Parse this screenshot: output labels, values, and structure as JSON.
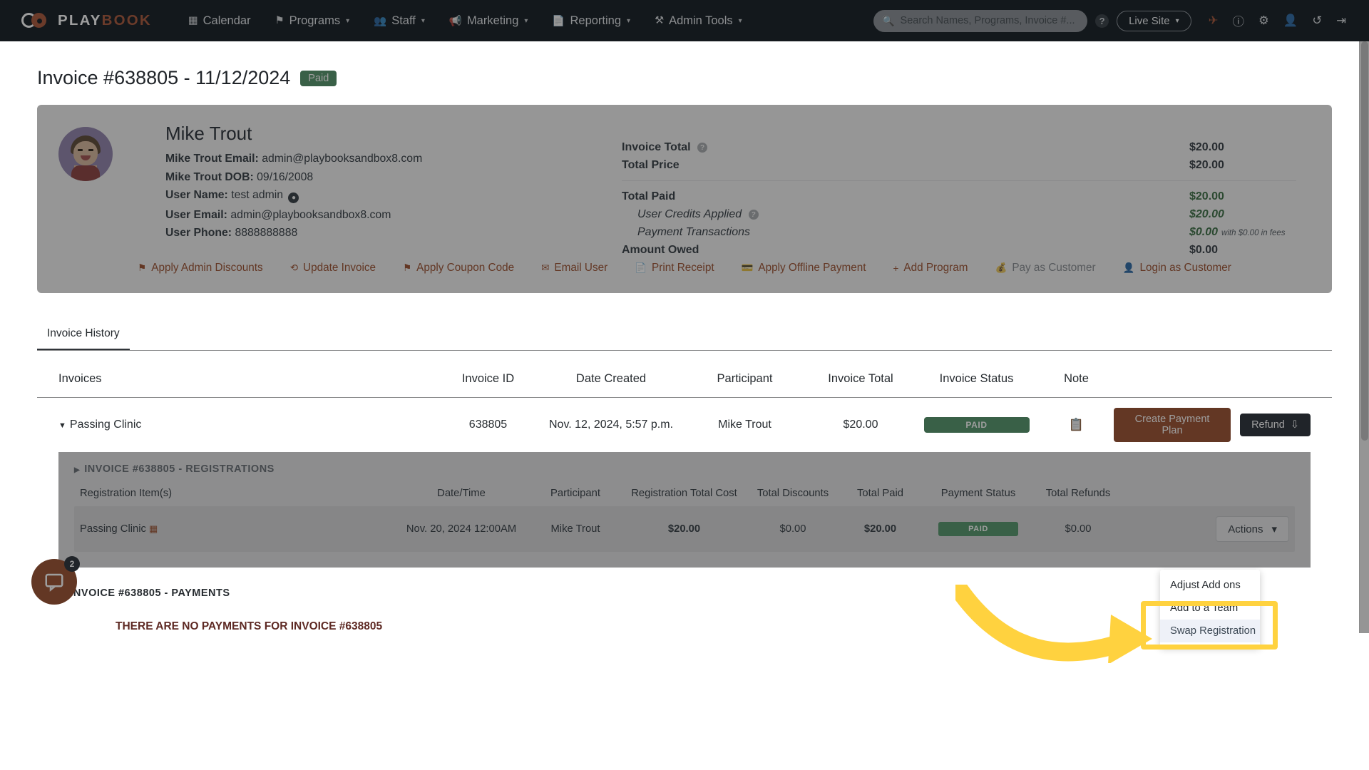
{
  "navbar": {
    "brand_word1": "PLAY",
    "brand_word2": "BOOK",
    "links": [
      {
        "label": "Calendar",
        "icon": "calendar-icon",
        "glyph": "☷",
        "caret": ""
      },
      {
        "label": "Programs",
        "icon": "flag-icon",
        "glyph": "⚑",
        "caret": "▾"
      },
      {
        "label": "Staff",
        "icon": "users-icon",
        "glyph": "●●",
        "caret": "▾"
      },
      {
        "label": "Marketing",
        "icon": "megaphone-icon",
        "glyph": "◤",
        "caret": "▾"
      },
      {
        "label": "Reporting",
        "icon": "document-icon",
        "glyph": "☷",
        "caret": "▾"
      },
      {
        "label": "Admin Tools",
        "icon": "wrench-icon",
        "glyph": "⚒",
        "caret": "▾"
      }
    ],
    "search_placeholder": "Search Names, Programs, Invoice #...",
    "search_value": "",
    "help_label": "?",
    "live_site_label": "Live Site",
    "right_icons": [
      {
        "name": "rocket-icon",
        "glyph": "✈"
      },
      {
        "name": "help-circle-icon",
        "glyph": "?"
      },
      {
        "name": "gear-icon",
        "glyph": "⚙"
      },
      {
        "name": "add-user-icon",
        "glyph": "☺"
      },
      {
        "name": "history-icon",
        "glyph": "↺"
      },
      {
        "name": "logout-icon",
        "glyph": "⇥"
      }
    ]
  },
  "page": {
    "title": "Invoice #638805 - 11/12/2024",
    "status_badge": "Paid"
  },
  "customer": {
    "name": "Mike Trout",
    "fields": [
      {
        "label": "Mike Trout Email:",
        "value": "admin@playbooksandbox8.com",
        "icon": ""
      },
      {
        "label": "Mike Trout DOB:",
        "value": "09/16/2008",
        "icon": ""
      },
      {
        "label": "User Name:",
        "value": "test admin",
        "icon": "user-circle-icon"
      },
      {
        "label": "User Email:",
        "value": "admin@playbooksandbox8.com",
        "icon": ""
      },
      {
        "label": "User Phone:",
        "value": "8888888888",
        "icon": ""
      }
    ]
  },
  "totals": {
    "rows": [
      {
        "label": "Invoice Total",
        "value": "$20.00",
        "help": true,
        "indent": false,
        "green": false,
        "bold": true
      },
      {
        "label": "Total Price",
        "value": "$20.00",
        "help": false,
        "indent": false,
        "green": false,
        "bold": true
      }
    ],
    "paid_rows": [
      {
        "label": "Total Paid",
        "value": "$20.00",
        "help": false,
        "indent": false,
        "green": true,
        "bold": true,
        "note": ""
      },
      {
        "label": "User Credits Applied",
        "value": "$20.00",
        "help": true,
        "indent": true,
        "green": true,
        "bold": false,
        "note": ""
      },
      {
        "label": "Payment Transactions",
        "value": "$0.00",
        "help": false,
        "indent": true,
        "green": true,
        "bold": false,
        "note": "with $0.00 in fees"
      },
      {
        "label": "Amount Owed",
        "value": "$0.00",
        "help": false,
        "indent": false,
        "green": false,
        "bold": true,
        "note": ""
      }
    ]
  },
  "card_actions": [
    {
      "label": "Apply Admin Discounts",
      "glyph": "⚑",
      "muted": false
    },
    {
      "label": "Update Invoice",
      "glyph": "⊙",
      "muted": false
    },
    {
      "label": "Apply Coupon Code",
      "glyph": "⚑",
      "muted": false
    },
    {
      "label": "Email User",
      "glyph": "✉",
      "muted": false
    },
    {
      "label": "Print Receipt",
      "glyph": "☷",
      "muted": false
    },
    {
      "label": "Apply Offline Payment",
      "glyph": "▣",
      "muted": false
    },
    {
      "label": "Add Program",
      "glyph": "+",
      "muted": false
    },
    {
      "label": "Pay as Customer",
      "glyph": "☷",
      "muted": true
    },
    {
      "label": "Login as Customer",
      "glyph": "☺",
      "muted": false
    }
  ],
  "tabs": [
    {
      "label": "Invoice History",
      "active": true
    }
  ],
  "invoice_table": {
    "headers": [
      "Invoices",
      "Invoice ID",
      "Date Created",
      "Participant",
      "Invoice Total",
      "Invoice Status",
      "Note"
    ],
    "row": {
      "invoice_name": "Passing Clinic",
      "invoice_id": "638805",
      "date_created": "Nov. 12, 2024, 5:57 p.m.",
      "participant": "Mike Trout",
      "invoice_total": "$20.00",
      "status": "PAID",
      "note_icon": "clipboard-icon",
      "create_payment_plan_label": "Create Payment Plan",
      "refund_label": "Refund"
    }
  },
  "registrations": {
    "section_title": "INVOICE #638805 - REGISTRATIONS",
    "headers": [
      "Registration Item(s)",
      "Date/Time",
      "Participant",
      "Registration Total Cost",
      "Total Discounts",
      "Total Paid",
      "Payment Status",
      "Total Refunds"
    ],
    "row": {
      "item": "Passing Clinic",
      "datetime": "Nov. 20, 2024 12:00AM",
      "participant": "Mike Trout",
      "total_cost": "$20.00",
      "total_discounts": "$0.00",
      "total_paid": "$20.00",
      "payment_status": "PAID",
      "total_refunds": "$0.00",
      "actions_label": "Actions"
    }
  },
  "payments": {
    "section_title": "INVOICE #638805 - PAYMENTS",
    "empty_message": "THERE ARE NO PAYMENTS FOR INVOICE #638805"
  },
  "dropdown": {
    "items": [
      {
        "label": "Adjust Add ons",
        "highlighted": false
      },
      {
        "label": "Add to a Team",
        "highlighted": false
      },
      {
        "label": "Swap Registration",
        "highlighted": true
      }
    ]
  },
  "chat": {
    "badge_count": "2"
  },
  "colors": {
    "accent_orange": "#c4511f",
    "nav_dark": "#1b2733",
    "paid_green": "#3fa463",
    "highlight_yellow": "#ffd23f",
    "danger_red": "#c0392b"
  }
}
